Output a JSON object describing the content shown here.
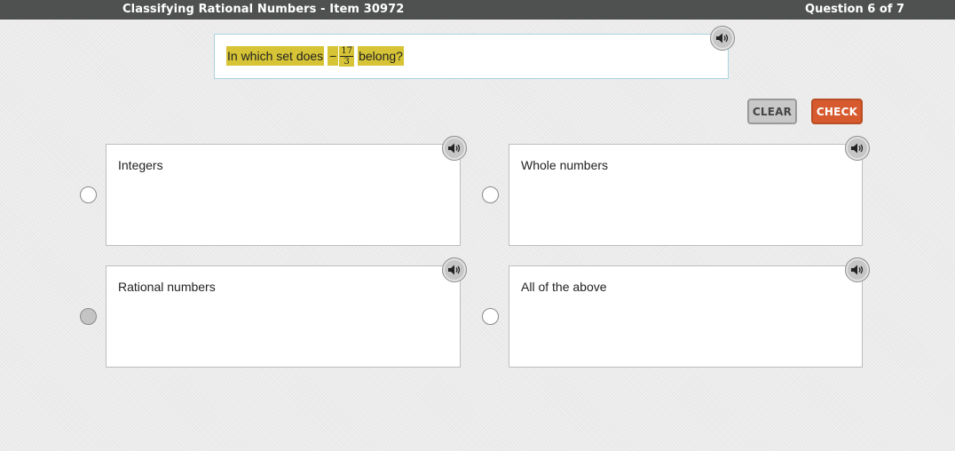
{
  "header": {
    "title": "Classifying Rational Numbers - Item 30972",
    "progress": "Question 6 of 7"
  },
  "question": {
    "prefix": "In which set does",
    "sign": "−",
    "numerator": "17",
    "denominator": "3",
    "suffix": "belong?"
  },
  "actions": {
    "clear_label": "CLEAR",
    "check_label": "CHECK"
  },
  "options": [
    {
      "label": "Integers",
      "selected": false
    },
    {
      "label": "Whole numbers",
      "selected": false
    },
    {
      "label": "Rational numbers",
      "selected": true
    },
    {
      "label": "All of the above",
      "selected": false
    }
  ],
  "colors": {
    "header_bg": "#4f5050",
    "highlight": "#d6c436",
    "check_button": "#d65a2e",
    "question_border": "#a8d3df"
  },
  "icons": {
    "read_aloud": "speaker-icon"
  }
}
